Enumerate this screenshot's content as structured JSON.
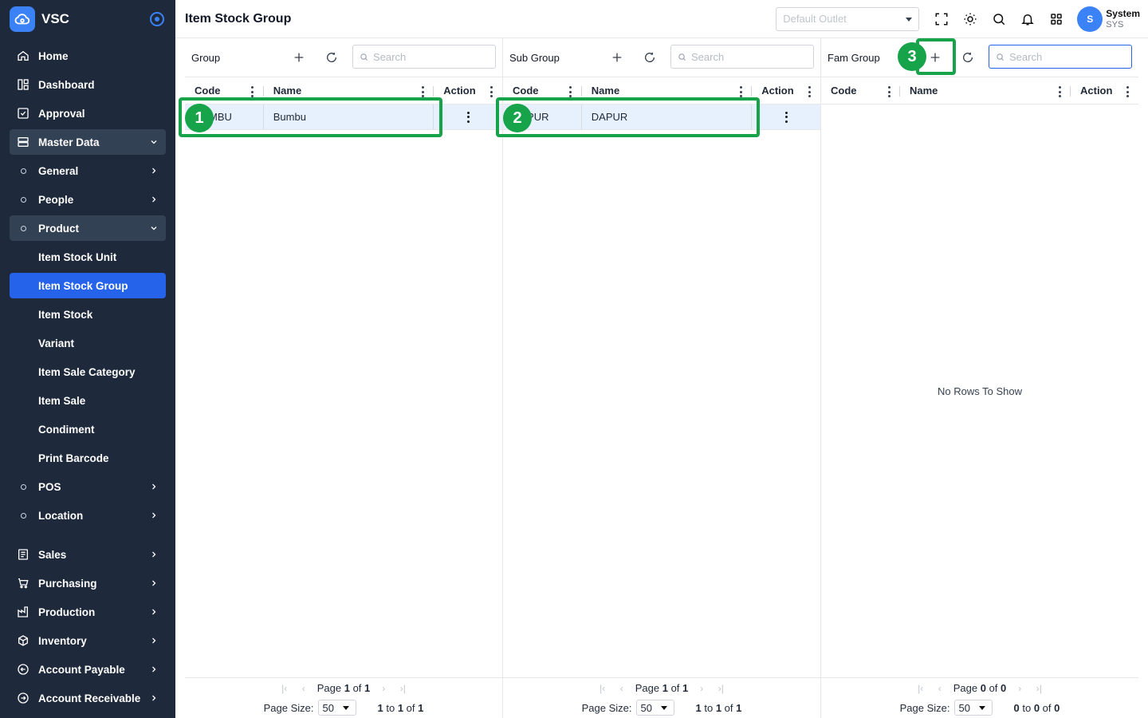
{
  "brand": {
    "name": "VSC"
  },
  "nav": {
    "home": "Home",
    "dashboard": "Dashboard",
    "approval": "Approval",
    "master_data": "Master Data",
    "general": "General",
    "people": "People",
    "product": "Product",
    "product_items": [
      "Item Stock Unit",
      "Item Stock Group",
      "Item Stock",
      "Variant",
      "Item Sale Category",
      "Item Sale",
      "Condiment",
      "Print Barcode"
    ],
    "pos": "POS",
    "location": "Location",
    "sales": "Sales",
    "purchasing": "Purchasing",
    "production": "Production",
    "inventory": "Inventory",
    "account_payable": "Account Payable",
    "account_receivable": "Account Receivable"
  },
  "topbar": {
    "title": "Item Stock Group",
    "outlet_placeholder": "Default Outlet",
    "user_initial": "S",
    "user_name": "System",
    "user_code": "SYS"
  },
  "panels": {
    "group": {
      "title": "Group",
      "search_placeholder": "Search",
      "columns": {
        "code": "Code",
        "name": "Name",
        "action": "Action"
      },
      "rows": [
        {
          "code": "BUMBU",
          "name": "Bumbu"
        }
      ],
      "pager": {
        "page_label": "Page",
        "page": "1",
        "of": "of",
        "pages": "1",
        "size_label": "Page Size:",
        "size": "50",
        "from": "1",
        "to_label": "to",
        "to": "1",
        "of2": "of",
        "total": "1"
      }
    },
    "subgroup": {
      "title": "Sub Group",
      "search_placeholder": "Search",
      "columns": {
        "code": "Code",
        "name": "Name",
        "action": "Action"
      },
      "rows": [
        {
          "code": "DAPUR",
          "name": "DAPUR"
        }
      ],
      "pager": {
        "page_label": "Page",
        "page": "1",
        "of": "of",
        "pages": "1",
        "size_label": "Page Size:",
        "size": "50",
        "from": "1",
        "to_label": "to",
        "to": "1",
        "of2": "of",
        "total": "1"
      }
    },
    "famgroup": {
      "title": "Fam Group",
      "search_placeholder": "Search",
      "columns": {
        "code": "Code",
        "name": "Name",
        "action": "Action"
      },
      "empty": "No Rows To Show",
      "pager": {
        "page_label": "Page",
        "page": "0",
        "of": "of",
        "pages": "0",
        "size_label": "Page Size:",
        "size": "50",
        "from": "0",
        "to_label": "to",
        "to": "0",
        "of2": "of",
        "total": "0"
      }
    }
  },
  "annotations": [
    "1",
    "2",
    "3"
  ],
  "colors": {
    "sidebar": "#1e293b",
    "accent": "#2563eb",
    "highlight": "#16a34a",
    "row_selected": "#e7f1fd"
  }
}
